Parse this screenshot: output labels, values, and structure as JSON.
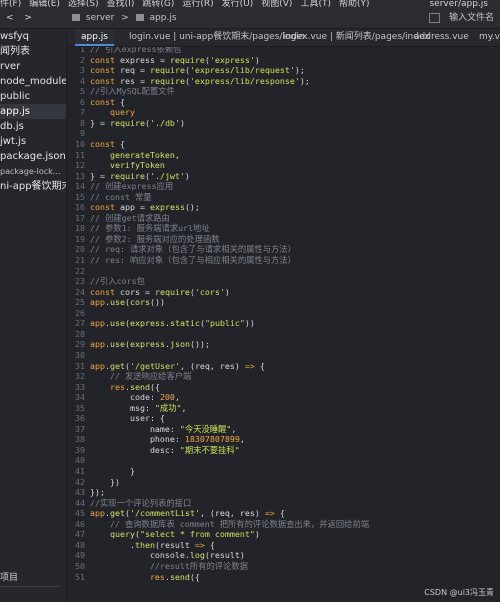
{
  "menubar": {
    "items": [
      "件(F)",
      "编辑(E)",
      "选择(S)",
      "查找(I)",
      "跳转(G)",
      "运行(R)",
      "发行(U)",
      "视图(V)",
      "工具(T)",
      "帮助(Y)"
    ],
    "path": "server/app.js"
  },
  "toolbar": {
    "back": "<",
    "forward": ">",
    "breadcrumb": [
      "server",
      ">",
      "app.js"
    ],
    "run_placeholder": "输入文件名"
  },
  "sidebar": {
    "items": [
      {
        "label": "wsfyq",
        "small": false,
        "active": false
      },
      {
        "label": "闻列表",
        "small": false,
        "active": false
      },
      {
        "label": "rver",
        "small": false,
        "active": false
      },
      {
        "label": "node_modules",
        "small": false,
        "active": false
      },
      {
        "label": "public",
        "small": false,
        "active": false
      },
      {
        "label": "app.js",
        "small": false,
        "active": true
      },
      {
        "label": "db.js",
        "small": false,
        "active": false
      },
      {
        "label": "jwt.js",
        "small": false,
        "active": false
      },
      {
        "label": "package.json",
        "small": false,
        "active": false
      },
      {
        "label": "package-lock...",
        "small": true,
        "active": false
      },
      {
        "label": "ni-app餐饮期末",
        "small": false,
        "active": false
      }
    ],
    "footer": "项目"
  },
  "tabs": [
    {
      "label": "app.js",
      "active": true
    },
    {
      "label": "login.vue | uni-app餐饮期末/pages/login",
      "active": false
    },
    {
      "label": "index.vue | 新闻列表/pages/index",
      "active": false
    },
    {
      "label": "address.vue",
      "active": false
    },
    {
      "label": "my.vu",
      "active": false
    }
  ],
  "code": [
    {
      "n": "1",
      "t": [
        [
          "// 引入express依赖包",
          "com"
        ]
      ]
    },
    {
      "n": "2",
      "t": [
        [
          "const ",
          "kw"
        ],
        [
          "express = ",
          "pl"
        ],
        [
          "require",
          "fn"
        ],
        [
          "(",
          "pl"
        ],
        [
          "'express'",
          "str"
        ],
        [
          ")",
          "pl"
        ]
      ]
    },
    {
      "n": "3",
      "t": [
        [
          "const ",
          "kw"
        ],
        [
          "req = ",
          "pl"
        ],
        [
          "require",
          "fn"
        ],
        [
          "(",
          "pl"
        ],
        [
          "'express/lib/request'",
          "str"
        ],
        [
          ");",
          "pl"
        ]
      ]
    },
    {
      "n": "4",
      "t": [
        [
          "const ",
          "kw"
        ],
        [
          "res = ",
          "pl"
        ],
        [
          "require",
          "fn"
        ],
        [
          "(",
          "pl"
        ],
        [
          "'express/lib/response'",
          "str"
        ],
        [
          ");",
          "pl"
        ]
      ]
    },
    {
      "n": "5",
      "t": [
        [
          "//引入MySQL配置文件",
          "com"
        ]
      ]
    },
    {
      "n": "6",
      "t": [
        [
          "const ",
          "kw"
        ],
        [
          "{",
          "pl"
        ]
      ]
    },
    {
      "n": "7",
      "t": [
        [
          "    query",
          "kw"
        ]
      ]
    },
    {
      "n": "8",
      "t": [
        [
          "} = ",
          "pl"
        ],
        [
          "require",
          "fn"
        ],
        [
          "(",
          "pl"
        ],
        [
          "'./db'",
          "str"
        ],
        [
          ")",
          "pl"
        ]
      ]
    },
    {
      "n": "9",
      "t": []
    },
    {
      "n": "10",
      "t": [
        [
          "const ",
          "kw"
        ],
        [
          "{",
          "pl"
        ]
      ]
    },
    {
      "n": "11",
      "t": [
        [
          "    generateToken,",
          "fn"
        ]
      ]
    },
    {
      "n": "12",
      "t": [
        [
          "    verifyToken",
          "fn"
        ]
      ]
    },
    {
      "n": "13",
      "t": [
        [
          "} = ",
          "pl"
        ],
        [
          "require",
          "fn"
        ],
        [
          "(",
          "pl"
        ],
        [
          "'./jwt'",
          "str"
        ],
        [
          ")",
          "pl"
        ]
      ]
    },
    {
      "n": "14",
      "t": [
        [
          "// 创建express应用",
          "com"
        ]
      ]
    },
    {
      "n": "15",
      "t": [
        [
          "// const 常量",
          "com"
        ]
      ]
    },
    {
      "n": "16",
      "t": [
        [
          "const ",
          "kw"
        ],
        [
          "app = ",
          "pl"
        ],
        [
          "express",
          "fn"
        ],
        [
          "();",
          "pl"
        ]
      ]
    },
    {
      "n": "17",
      "t": [
        [
          "// 创建get请求路由",
          "com"
        ]
      ]
    },
    {
      "n": "18",
      "t": [
        [
          "// 参数1: 服务端请求url地址",
          "com"
        ]
      ]
    },
    {
      "n": "19",
      "t": [
        [
          "// 参数2: 服务端对应的处理函数",
          "com"
        ]
      ]
    },
    {
      "n": "20",
      "t": [
        [
          "// req: 请求对象（包含了与请求相关的属性与方法）",
          "com"
        ]
      ]
    },
    {
      "n": "21",
      "t": [
        [
          "// res: 响应对象（包含了与相应相关的属性与方法）",
          "com"
        ]
      ]
    },
    {
      "n": "22",
      "t": []
    },
    {
      "n": "23",
      "t": [
        [
          "//引入cors包",
          "com"
        ]
      ]
    },
    {
      "n": "24",
      "t": [
        [
          "const ",
          "kw"
        ],
        [
          "cors = ",
          "pl"
        ],
        [
          "require",
          "fn"
        ],
        [
          "(",
          "pl"
        ],
        [
          "'cors'",
          "str"
        ],
        [
          ")",
          "pl"
        ]
      ]
    },
    {
      "n": "25",
      "t": [
        [
          "app",
          "kw"
        ],
        [
          ".",
          "pl"
        ],
        [
          "use",
          "fn"
        ],
        [
          "(",
          "pl"
        ],
        [
          "cors",
          "fn"
        ],
        [
          "())",
          "pl"
        ]
      ]
    },
    {
      "n": "26",
      "t": []
    },
    {
      "n": "27",
      "t": [
        [
          "app",
          "kw"
        ],
        [
          ".",
          "pl"
        ],
        [
          "use",
          "fn"
        ],
        [
          "(",
          "pl"
        ],
        [
          "express",
          "fn"
        ],
        [
          ".",
          "pl"
        ],
        [
          "static",
          "fn"
        ],
        [
          "(",
          "pl"
        ],
        [
          "\"public\"",
          "str"
        ],
        [
          "))",
          "pl"
        ]
      ]
    },
    {
      "n": "28",
      "t": []
    },
    {
      "n": "29",
      "t": [
        [
          "app",
          "kw"
        ],
        [
          ".",
          "pl"
        ],
        [
          "use",
          "fn"
        ],
        [
          "(",
          "pl"
        ],
        [
          "express",
          "fn"
        ],
        [
          ".",
          "pl"
        ],
        [
          "json",
          "fn"
        ],
        [
          "());",
          "pl"
        ]
      ]
    },
    {
      "n": "30",
      "t": []
    },
    {
      "n": "31",
      "t": [
        [
          "app",
          "kw"
        ],
        [
          ".",
          "pl"
        ],
        [
          "get",
          "fn"
        ],
        [
          "(",
          "pl"
        ],
        [
          "'/getUser'",
          "str"
        ],
        [
          ", (req, res) ",
          "pl"
        ],
        [
          "=>",
          "kw"
        ],
        [
          " {",
          "pl"
        ]
      ]
    },
    {
      "n": "32",
      "t": [
        [
          "    // 发送响应给客户端",
          "com"
        ]
      ]
    },
    {
      "n": "33",
      "t": [
        [
          "    res",
          "kw"
        ],
        [
          ".",
          "pl"
        ],
        [
          "send",
          "fn"
        ],
        [
          "({",
          "pl"
        ]
      ]
    },
    {
      "n": "34",
      "t": [
        [
          "        code: ",
          "pl"
        ],
        [
          "200",
          "num"
        ],
        [
          ",",
          "pl"
        ]
      ]
    },
    {
      "n": "35",
      "t": [
        [
          "        msg: ",
          "pl"
        ],
        [
          "\"成功\"",
          "str"
        ],
        [
          ",",
          "pl"
        ]
      ]
    },
    {
      "n": "36",
      "t": [
        [
          "        user: {",
          "pl"
        ]
      ]
    },
    {
      "n": "37",
      "t": [
        [
          "            name: ",
          "pl"
        ],
        [
          "\"今天没睡醒\"",
          "str"
        ],
        [
          ",",
          "pl"
        ]
      ]
    },
    {
      "n": "38",
      "t": [
        [
          "            phone: ",
          "pl"
        ],
        [
          "18307807899",
          "num"
        ],
        [
          ",",
          "pl"
        ]
      ]
    },
    {
      "n": "39",
      "t": [
        [
          "            desc: ",
          "pl"
        ],
        [
          "\"期末不要挂科\"",
          "str"
        ]
      ]
    },
    {
      "n": "40",
      "t": []
    },
    {
      "n": "41",
      "t": [
        [
          "        }",
          "pl"
        ]
      ]
    },
    {
      "n": "42",
      "t": [
        [
          "    })",
          "pl"
        ]
      ]
    },
    {
      "n": "43",
      "t": [
        [
          "});",
          "pl"
        ]
      ]
    },
    {
      "n": "44",
      "t": [
        [
          "//实现一个评论列表的接口",
          "com"
        ]
      ]
    },
    {
      "n": "45",
      "t": [
        [
          "app",
          "kw"
        ],
        [
          ".",
          "pl"
        ],
        [
          "get",
          "fn"
        ],
        [
          "(",
          "pl"
        ],
        [
          "'/commentList'",
          "str"
        ],
        [
          ", (req, res) ",
          "pl"
        ],
        [
          "=>",
          "kw"
        ],
        [
          " {",
          "pl"
        ]
      ]
    },
    {
      "n": "46",
      "t": [
        [
          "    // 查询数据库表 comment 把所有的评论数据查出来，并返回给前端",
          "com"
        ]
      ]
    },
    {
      "n": "47",
      "t": [
        [
          "    query",
          "fn"
        ],
        [
          "(",
          "pl"
        ],
        [
          "\"select * from comment\"",
          "str"
        ],
        [
          ")",
          "pl"
        ]
      ]
    },
    {
      "n": "48",
      "t": [
        [
          "        .",
          "pl"
        ],
        [
          "then",
          "fn"
        ],
        [
          "(result ",
          "pl"
        ],
        [
          "=>",
          "kw"
        ],
        [
          " {",
          "pl"
        ]
      ]
    },
    {
      "n": "49",
      "t": [
        [
          "            console",
          "pl"
        ],
        [
          ".",
          "pl"
        ],
        [
          "log",
          "fn"
        ],
        [
          "(result)",
          "pl"
        ]
      ]
    },
    {
      "n": "50",
      "t": [
        [
          "            //result所有的评论数据",
          "com"
        ]
      ]
    },
    {
      "n": "51",
      "t": [
        [
          "            res",
          "kw"
        ],
        [
          ".",
          "pl"
        ],
        [
          "send",
          "fn"
        ],
        [
          "({",
          "pl"
        ]
      ]
    }
  ],
  "watermark": "CSDN @ui3冯玉青",
  "colors": {
    "keyword": "#f0a440",
    "string": "#c9e05a",
    "comment": "#7e828a",
    "number": "#f2a54a",
    "function": "#d0e36b",
    "accent": "#4f8bd6"
  }
}
